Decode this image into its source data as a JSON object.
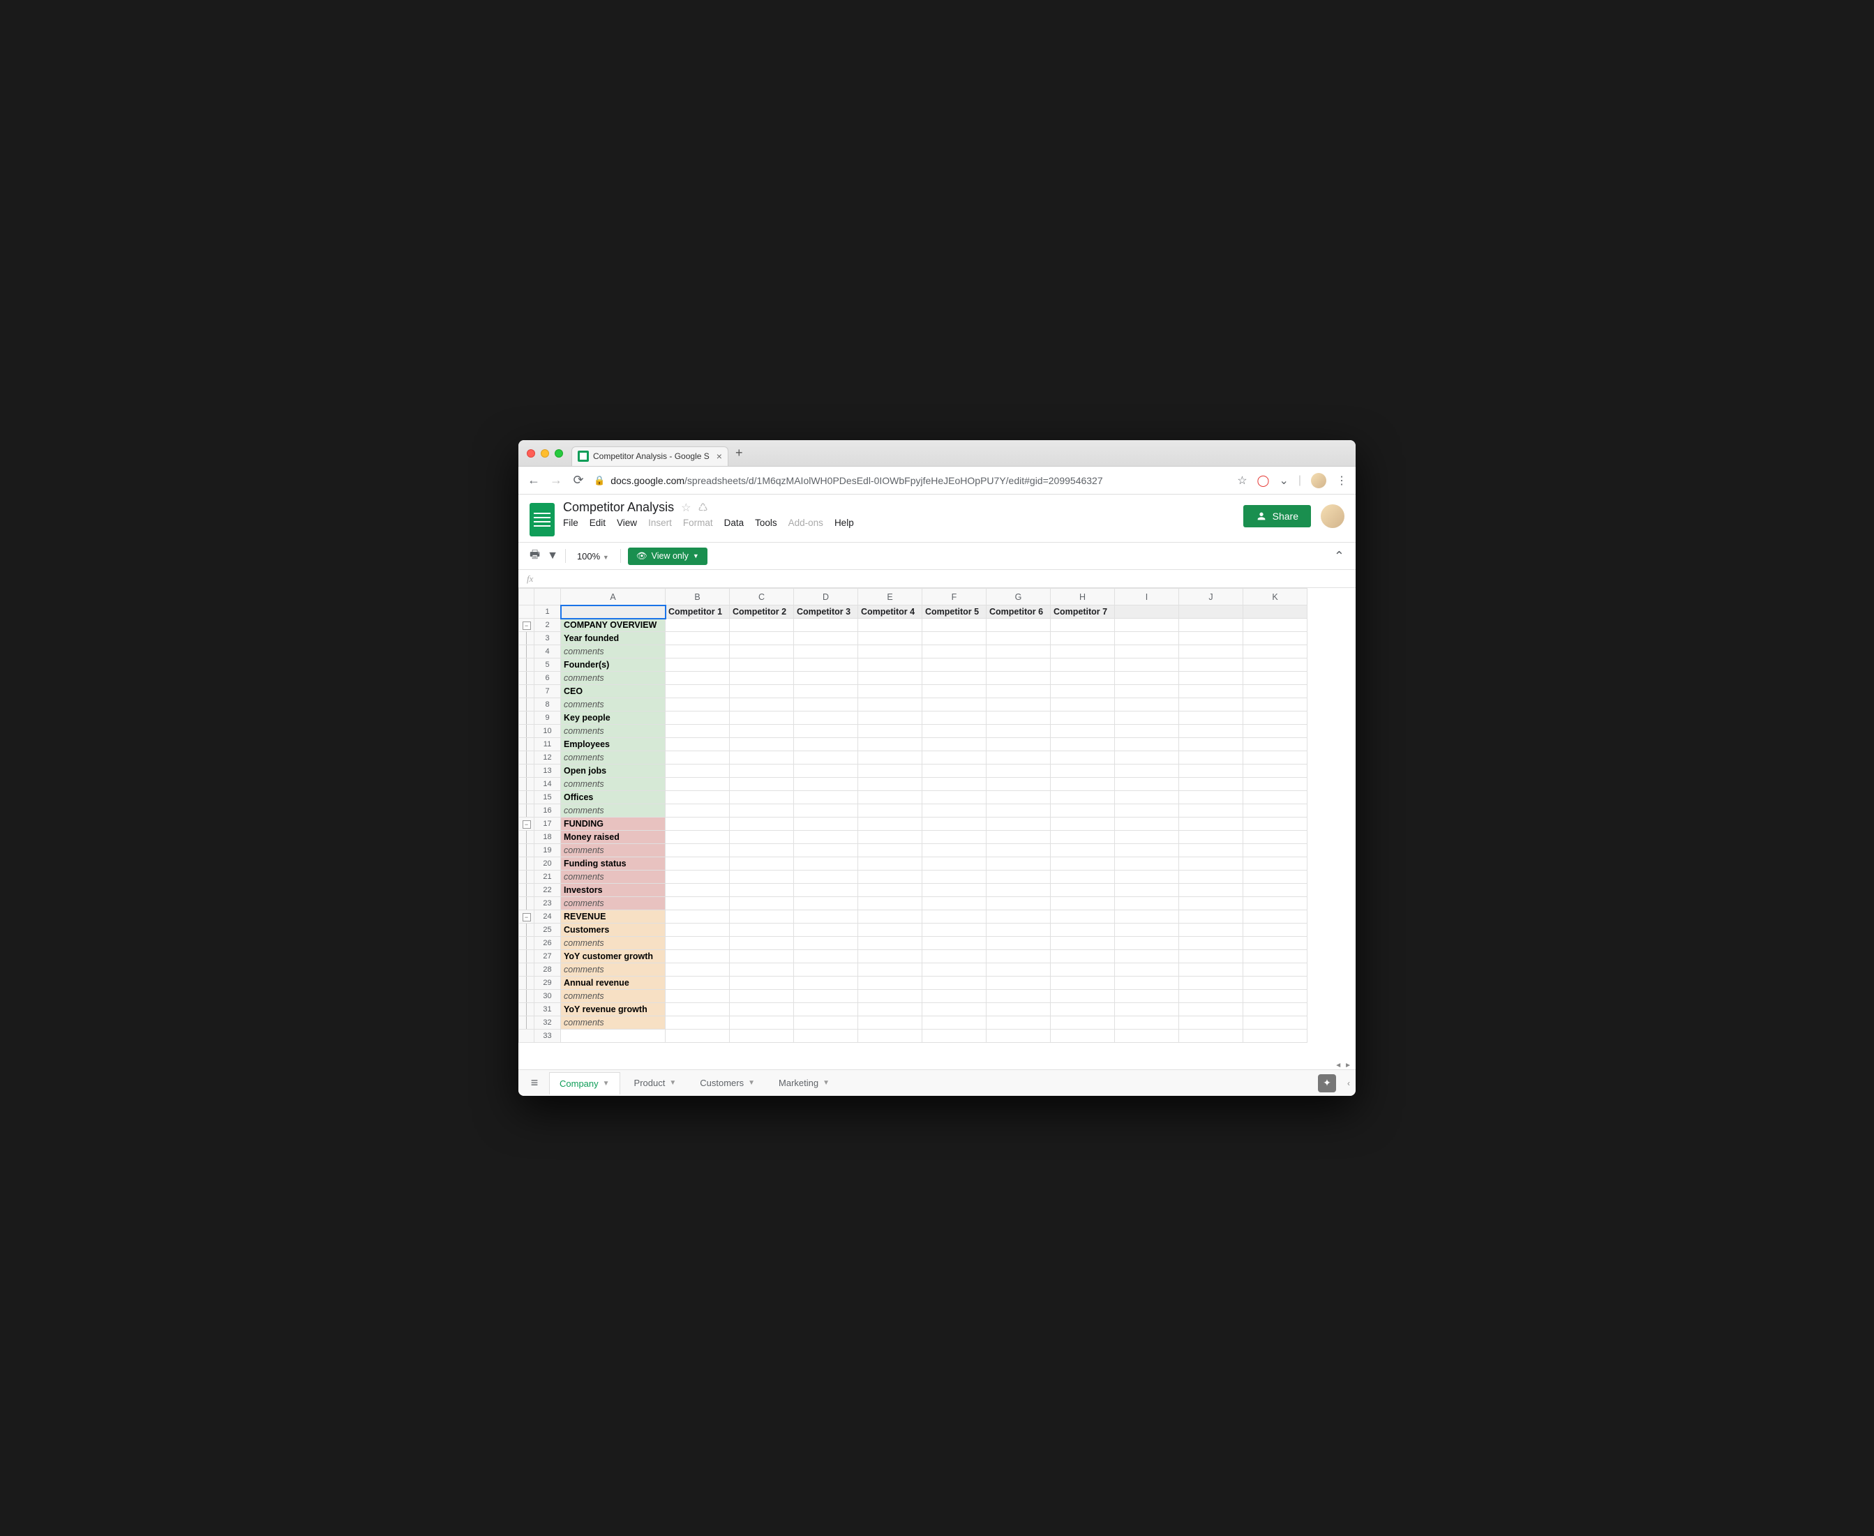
{
  "browser": {
    "tab_title": "Competitor Analysis - Google S",
    "url_domain": "docs.google.com",
    "url_path": "/spreadsheets/d/1M6qzMAIolWH0PDesEdl-0IOWbFpyjfeHeJEoHOpPU7Y/edit#gid=2099546327"
  },
  "doc": {
    "title": "Competitor Analysis",
    "menus": [
      "File",
      "Edit",
      "View",
      "Insert",
      "Format",
      "Data",
      "Tools",
      "Add-ons",
      "Help"
    ],
    "disabled_menus": [
      "Insert",
      "Format",
      "Add-ons"
    ],
    "share_label": "Share"
  },
  "toolbar": {
    "zoom": "100%",
    "view_only": "View only"
  },
  "columns": [
    "A",
    "B",
    "C",
    "D",
    "E",
    "F",
    "G",
    "H",
    "I",
    "J",
    "K"
  ],
  "headers_row1": [
    "",
    "Competitor 1",
    "Competitor 2",
    "Competitor 3",
    "Competitor 4",
    "Competitor 5",
    "Competitor 6",
    "Competitor 7",
    "",
    "",
    ""
  ],
  "rows": [
    {
      "n": 2,
      "label": "COMPANY OVERVIEW",
      "cls": "section-green bold",
      "group_btn": true
    },
    {
      "n": 3,
      "label": "Year founded",
      "cls": "section-green bold",
      "group_line": true
    },
    {
      "n": 4,
      "label": "comments",
      "cls": "section-green italic",
      "group_line": true
    },
    {
      "n": 5,
      "label": "Founder(s)",
      "cls": "section-green bold",
      "group_line": true
    },
    {
      "n": 6,
      "label": "comments",
      "cls": "section-green italic",
      "group_line": true
    },
    {
      "n": 7,
      "label": "CEO",
      "cls": "section-green bold",
      "group_line": true
    },
    {
      "n": 8,
      "label": "comments",
      "cls": "section-green italic",
      "group_line": true
    },
    {
      "n": 9,
      "label": "Key people",
      "cls": "section-green bold",
      "group_line": true
    },
    {
      "n": 10,
      "label": "comments",
      "cls": "section-green italic",
      "group_line": true
    },
    {
      "n": 11,
      "label": "Employees",
      "cls": "section-green bold",
      "group_line": true
    },
    {
      "n": 12,
      "label": "comments",
      "cls": "section-green italic",
      "group_line": true
    },
    {
      "n": 13,
      "label": "Open jobs",
      "cls": "section-green bold",
      "group_line": true
    },
    {
      "n": 14,
      "label": "comments",
      "cls": "section-green italic",
      "group_line": true
    },
    {
      "n": 15,
      "label": "Offices",
      "cls": "section-green bold",
      "group_line": true
    },
    {
      "n": 16,
      "label": "comments",
      "cls": "section-green italic",
      "group_line": true
    },
    {
      "n": 17,
      "label": "FUNDING",
      "cls": "section-red bold",
      "group_btn": true
    },
    {
      "n": 18,
      "label": "Money raised",
      "cls": "section-red bold",
      "group_line": true
    },
    {
      "n": 19,
      "label": "comments",
      "cls": "section-red italic",
      "group_line": true
    },
    {
      "n": 20,
      "label": "Funding status",
      "cls": "section-red bold",
      "group_line": true
    },
    {
      "n": 21,
      "label": "comments",
      "cls": "section-red italic",
      "group_line": true
    },
    {
      "n": 22,
      "label": "Investors",
      "cls": "section-red bold",
      "group_line": true
    },
    {
      "n": 23,
      "label": "comments",
      "cls": "section-red italic",
      "group_line": true
    },
    {
      "n": 24,
      "label": "REVENUE",
      "cls": "section-orange bold",
      "group_btn": true
    },
    {
      "n": 25,
      "label": "Customers",
      "cls": "section-orange bold",
      "group_line": true
    },
    {
      "n": 26,
      "label": "comments",
      "cls": "section-orange italic",
      "group_line": true
    },
    {
      "n": 27,
      "label": "YoY customer growth",
      "cls": "section-orange bold",
      "group_line": true
    },
    {
      "n": 28,
      "label": "comments",
      "cls": "section-orange italic",
      "group_line": true
    },
    {
      "n": 29,
      "label": "Annual revenue",
      "cls": "section-orange bold",
      "group_line": true
    },
    {
      "n": 30,
      "label": "comments",
      "cls": "section-orange italic",
      "group_line": true
    },
    {
      "n": 31,
      "label": "YoY revenue growth",
      "cls": "section-orange bold",
      "group_line": true
    },
    {
      "n": 32,
      "label": "comments",
      "cls": "section-orange italic",
      "group_line": true
    },
    {
      "n": 33,
      "label": "",
      "cls": ""
    }
  ],
  "sheets": [
    {
      "name": "Company",
      "active": true
    },
    {
      "name": "Product",
      "active": false
    },
    {
      "name": "Customers",
      "active": false
    },
    {
      "name": "Marketing",
      "active": false
    }
  ]
}
